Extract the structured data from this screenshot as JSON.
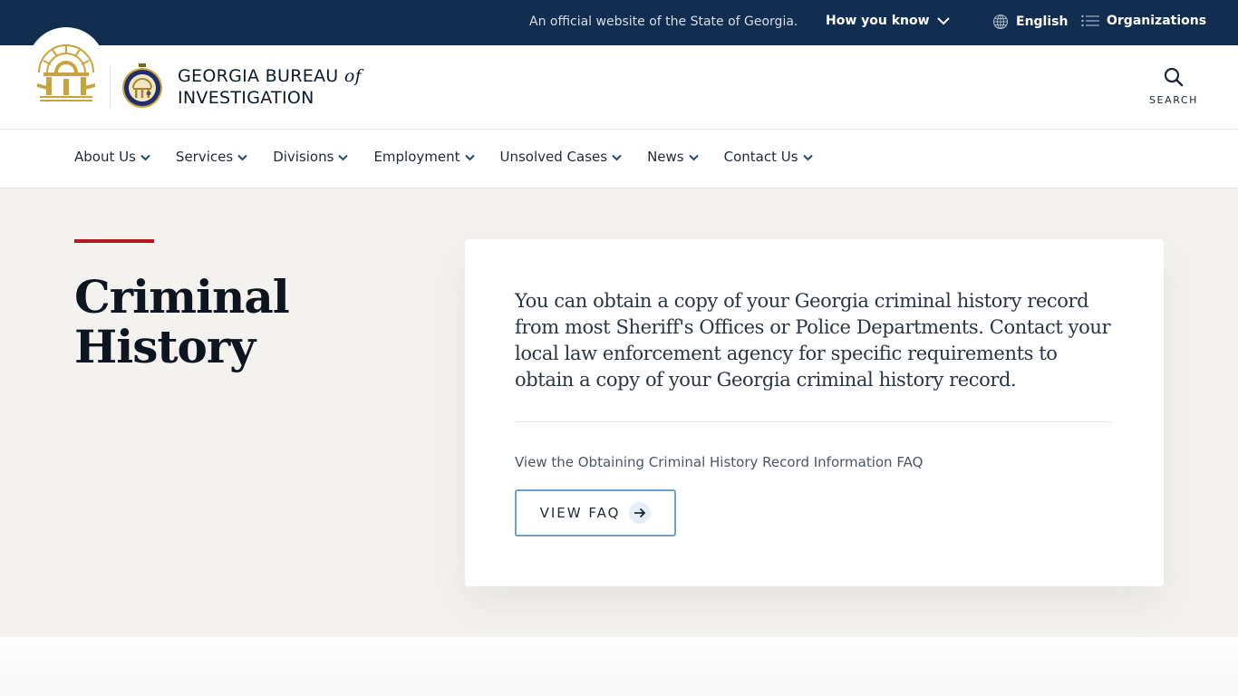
{
  "banner": {
    "official_text": "An official website of the State of Georgia.",
    "how_you_know": "How you know",
    "language": "English",
    "organizations": "Organizations",
    "icons": {
      "how_you_know": "chevron-down-icon",
      "language": "globe-icon",
      "organizations": "list-icon"
    }
  },
  "header": {
    "site_name_line1": "GEORGIA BUREAU",
    "site_name_of": "of",
    "site_name_line2": "INVESTIGATION",
    "search_label": "SEARCH",
    "logos": [
      "georgia-capitol-arch-logo",
      "gbi-seal-logo"
    ]
  },
  "nav": {
    "items": [
      {
        "label": "About Us"
      },
      {
        "label": "Services"
      },
      {
        "label": "Divisions"
      },
      {
        "label": "Employment"
      },
      {
        "label": "Unsolved Cases"
      },
      {
        "label": "News"
      },
      {
        "label": "Contact Us"
      }
    ]
  },
  "hero": {
    "title_line1": "Criminal",
    "title_line2": "History",
    "lead": "You can obtain a copy of your Georgia criminal history record from most Sheriff's Offices or Police Departments. Contact your local law enforcement agency for specific requirements to obtain a copy of your Georgia criminal history record.",
    "faq_description": "View the Obtaining Criminal History Record Information FAQ",
    "faq_button": "VIEW FAQ"
  },
  "colors": {
    "banner_bg": "#112e51",
    "accent_red": "#b3191e",
    "gold": "#c9a33b",
    "hero_bg": "#f3f2ef",
    "button_border": "#6b9fcf"
  }
}
